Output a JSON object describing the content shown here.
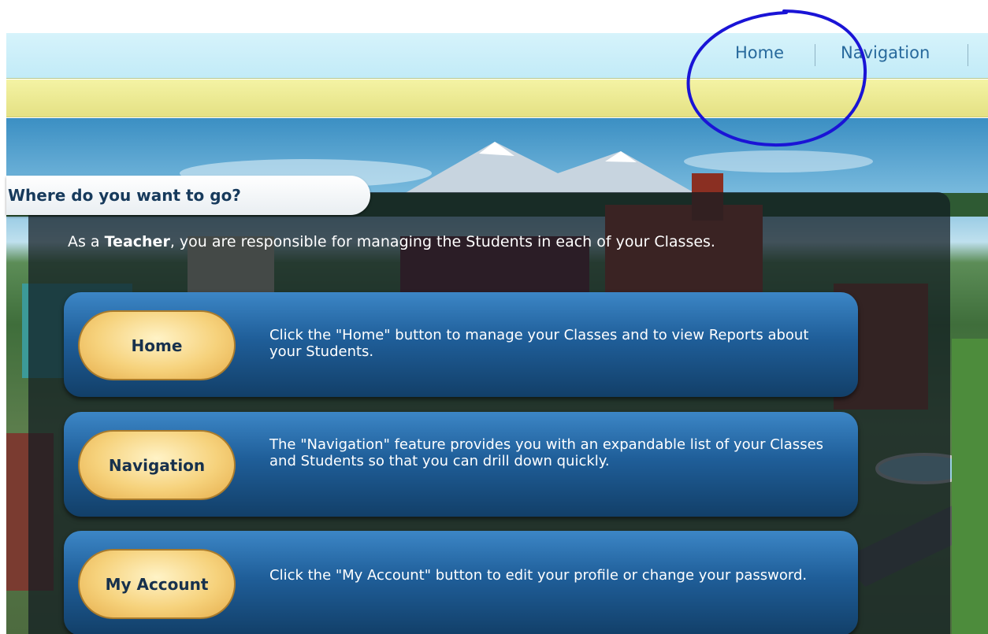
{
  "topnav": {
    "links": [
      {
        "label": "Home"
      },
      {
        "label": "Navigation"
      }
    ]
  },
  "panel": {
    "title": "Where do you want to go?",
    "intro_prefix": "As a ",
    "intro_role": "Teacher",
    "intro_suffix": ", you are responsible for managing the Students in each of your Classes.",
    "cards": [
      {
        "button_label": "Home",
        "description": "Click the \"Home\" button to manage your Classes and to view Reports about your Students."
      },
      {
        "button_label": "Navigation",
        "description": "The \"Navigation\" feature provides you with an expandable list of your Classes and Students so that you can drill down quickly."
      },
      {
        "button_label": "My Account",
        "description": "Click the \"My Account\" button to edit your profile or change your password."
      }
    ]
  },
  "colors": {
    "nav_bg": "#c2ebf7",
    "nav_link": "#27699c",
    "yellow_bar": "#e4e184",
    "card_blue": "#1f5e99",
    "button_gold": "#f6d27c",
    "annotation": "#1a14d6"
  }
}
